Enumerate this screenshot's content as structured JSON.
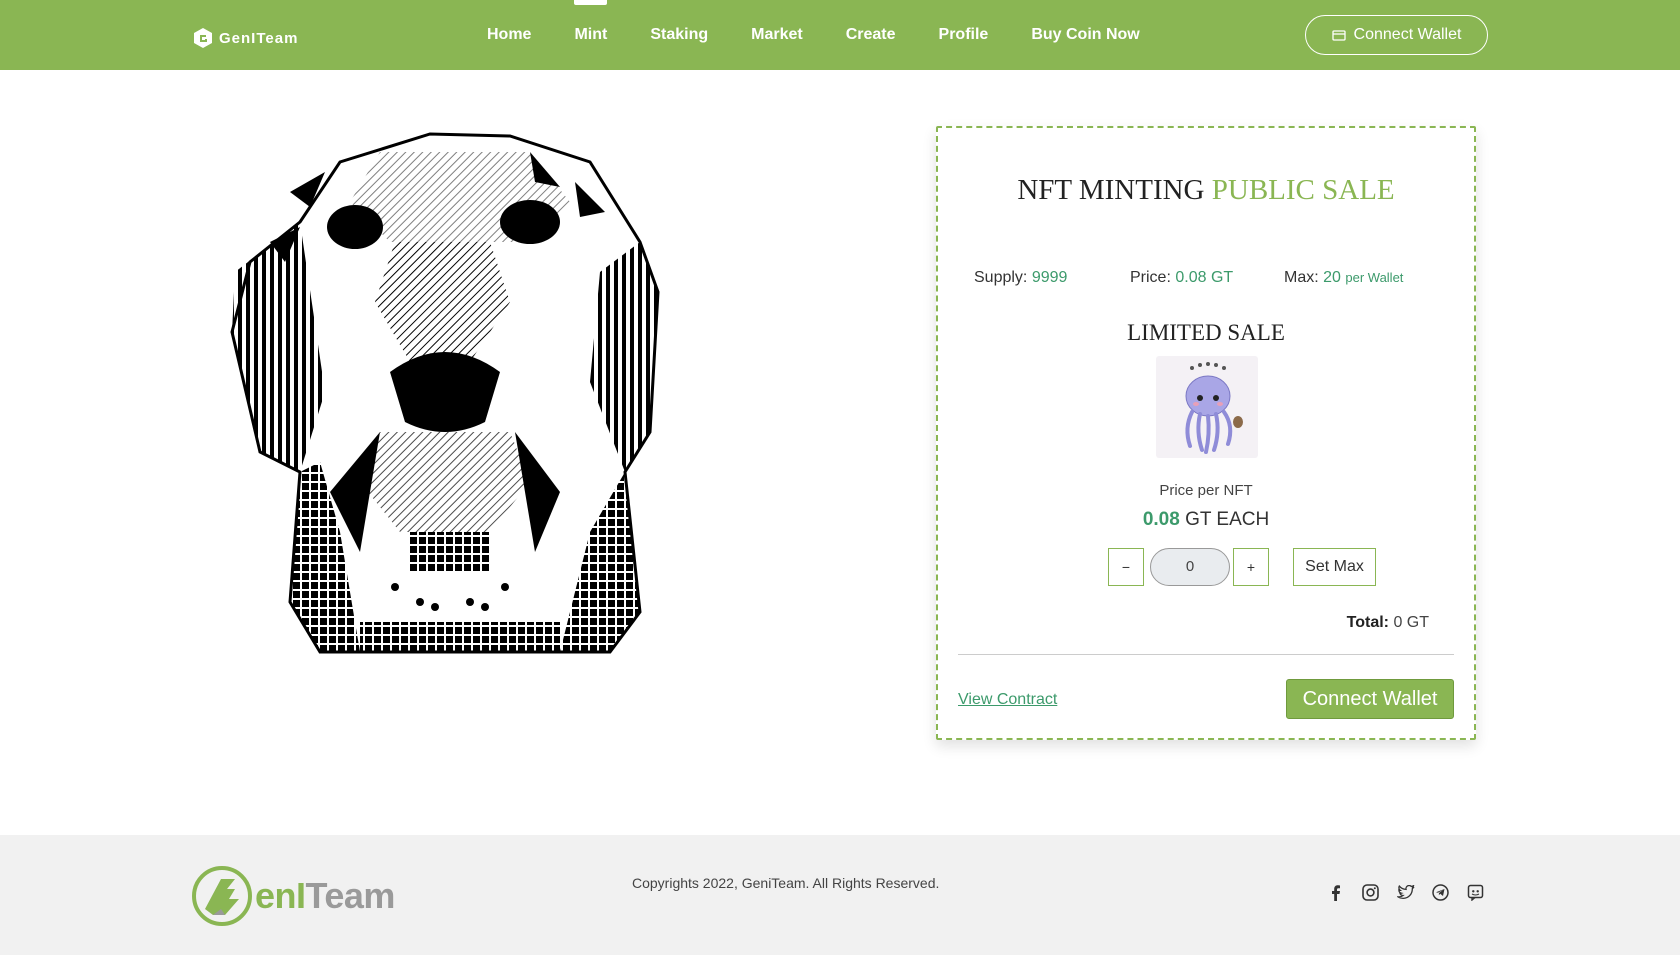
{
  "nav": {
    "brand": "GenITeam",
    "links": [
      "Home",
      "Mint",
      "Staking",
      "Market",
      "Create",
      "Profile",
      "Buy Coin Now"
    ],
    "active": "Mint",
    "connect_label": "Connect Wallet"
  },
  "card": {
    "title_main": "NFT MINTING",
    "title_accent": "PUBLIC SALE",
    "supply_label": "Supply:",
    "supply_value": "9999",
    "price_label": "Price:",
    "price_value": "0.08 GT",
    "max_label": "Max:",
    "max_value": "20",
    "max_suffix": "per Wallet",
    "limited_label": "LIMITED SALE",
    "price_per_label": "Price per NFT",
    "price_each_value": "0.08",
    "price_each_suffix": "GT EACH",
    "qty_minus": "−",
    "qty_value": "0",
    "qty_plus": "+",
    "set_max": "Set Max",
    "total_label": "Total:",
    "total_value": "0 GT",
    "view_contract": "View Contract",
    "connect_label": "Connect Wallet"
  },
  "footer": {
    "logo_accent": "enI",
    "logo_rest": "Team",
    "copyright": "Copyrights 2022, GeniTeam. All Rights Reserved.",
    "socials": [
      "facebook-icon",
      "instagram-icon",
      "twitter-icon",
      "telegram-icon",
      "discord-icon"
    ]
  },
  "colors": {
    "brand": "#8ab653",
    "value": "#3c9a6b",
    "footer_bg": "#f1f1f1"
  }
}
